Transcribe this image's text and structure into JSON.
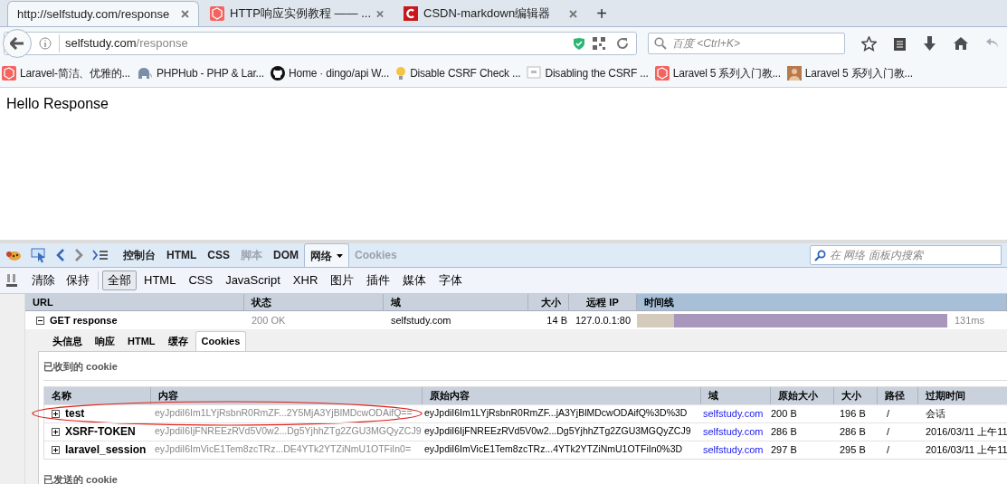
{
  "browser": {
    "tabs": [
      {
        "title": "http://selfstudy.com/response",
        "selected": true,
        "kind": "none"
      },
      {
        "title": "HTTP响应实例教程 —— ...",
        "selected": false,
        "kind": "laravel"
      },
      {
        "title": "CSDN-markdown编辑器",
        "selected": false,
        "kind": "csdn"
      }
    ],
    "new_tab": "+",
    "address": {
      "host": "selfstudy.com",
      "path": "/response"
    },
    "search": {
      "placeholder": "百度 <Ctrl+K>"
    },
    "bookmarks": [
      {
        "label": "Laravel-简洁、优雅的...",
        "kind": "laravel"
      },
      {
        "label": "PHPHub - PHP & Lar...",
        "kind": "elephant"
      },
      {
        "label": "Home · dingo/api W...",
        "kind": "github"
      },
      {
        "label": "Disable CSRF Check ...",
        "kind": "bulb"
      },
      {
        "label": "Disabling the CSRF ...",
        "kind": "page"
      },
      {
        "label": "Laravel 5 系列入门教...",
        "kind": "laravel"
      },
      {
        "label": "Laravel 5 系列入门教...",
        "kind": "avatar"
      }
    ]
  },
  "page": {
    "text": "Hello Response"
  },
  "devtools": {
    "panel_tabs": [
      {
        "label": "控制台",
        "selected": false,
        "disabled": false
      },
      {
        "label": "HTML",
        "selected": false,
        "disabled": false
      },
      {
        "label": "CSS",
        "selected": false,
        "disabled": false
      },
      {
        "label": "脚本",
        "selected": false,
        "disabled": true
      },
      {
        "label": "DOM",
        "selected": false,
        "disabled": false
      },
      {
        "label": "网络",
        "selected": true,
        "disabled": false
      },
      {
        "label": "Cookies",
        "selected": false,
        "disabled": true
      }
    ],
    "search": {
      "placeholder": "在 网络 面板内搜索"
    },
    "actions": [
      "清除",
      "保持"
    ],
    "filters": [
      {
        "label": "全部",
        "selected": true
      },
      {
        "label": "HTML",
        "selected": false
      },
      {
        "label": "CSS",
        "selected": false
      },
      {
        "label": "JavaScript",
        "selected": false
      },
      {
        "label": "XHR",
        "selected": false
      },
      {
        "label": "图片",
        "selected": false
      },
      {
        "label": "插件",
        "selected": false
      },
      {
        "label": "媒体",
        "selected": false
      },
      {
        "label": "字体",
        "selected": false
      }
    ],
    "columns": [
      "URL",
      "状态",
      "域",
      "大小",
      "远程 IP",
      "时间线"
    ],
    "request": {
      "expanded": true,
      "url": "GET response",
      "status": "200 OK",
      "domain": "selfstudy.com",
      "size": "14 B",
      "ip": "127.0.0.1:80",
      "time": "131ms"
    },
    "detail_tabs": [
      {
        "label": "头信息",
        "selected": false
      },
      {
        "label": "响应",
        "selected": false
      },
      {
        "label": "HTML",
        "selected": false
      },
      {
        "label": "缓存",
        "selected": false
      },
      {
        "label": "Cookies",
        "selected": true
      }
    ],
    "received_title": "已收到的 cookie",
    "cookie_columns": [
      "名称",
      "内容",
      "原始内容",
      "域",
      "原始大小",
      "大小",
      "路径",
      "过期时间"
    ],
    "cookies": [
      {
        "name": "test",
        "expanded": false,
        "highlighted": true,
        "value": "eyJpdiI6Im1LYjRsbnR0RmZF...2Y5MjA3YjBlMDcwODAifQ==",
        "raw": "eyJpdiI6Im1LYjRsbnR0RmZF...jA3YjBlMDcwODAifQ%3D%3D",
        "domain": "selfstudy.com",
        "raw_size": "200 B",
        "size": "196 B",
        "path": "/",
        "expires": "会话"
      },
      {
        "name": "XSRF-TOKEN",
        "expanded": false,
        "highlighted": false,
        "value": "eyJpdiI6IjFNREEzRVd5V0w2...Dg5YjhhZTg2ZGU3MGQyZCJ9",
        "raw": "eyJpdiI6IjFNREEzRVd5V0w2...Dg5YjhhZTg2ZGU3MGQyZCJ9",
        "domain": "selfstudy.com",
        "raw_size": "286 B",
        "size": "286 B",
        "path": "/",
        "expires": "2016/03/11 上午11"
      },
      {
        "name": "laravel_session",
        "expanded": false,
        "highlighted": false,
        "value": "eyJpdiI6ImVicE1Tem8zcTRz...DE4YTk2YTZiNmU1OTFiIn0=",
        "raw": "eyJpdiI6ImVicE1Tem8zcTRz...4YTk2YTZiNmU1OTFiIn0%3D",
        "domain": "selfstudy.com",
        "raw_size": "297 B",
        "size": "295 B",
        "path": "/",
        "expires": "2016/03/11 上午11"
      }
    ],
    "sent_title": "已发送的 cookie"
  }
}
